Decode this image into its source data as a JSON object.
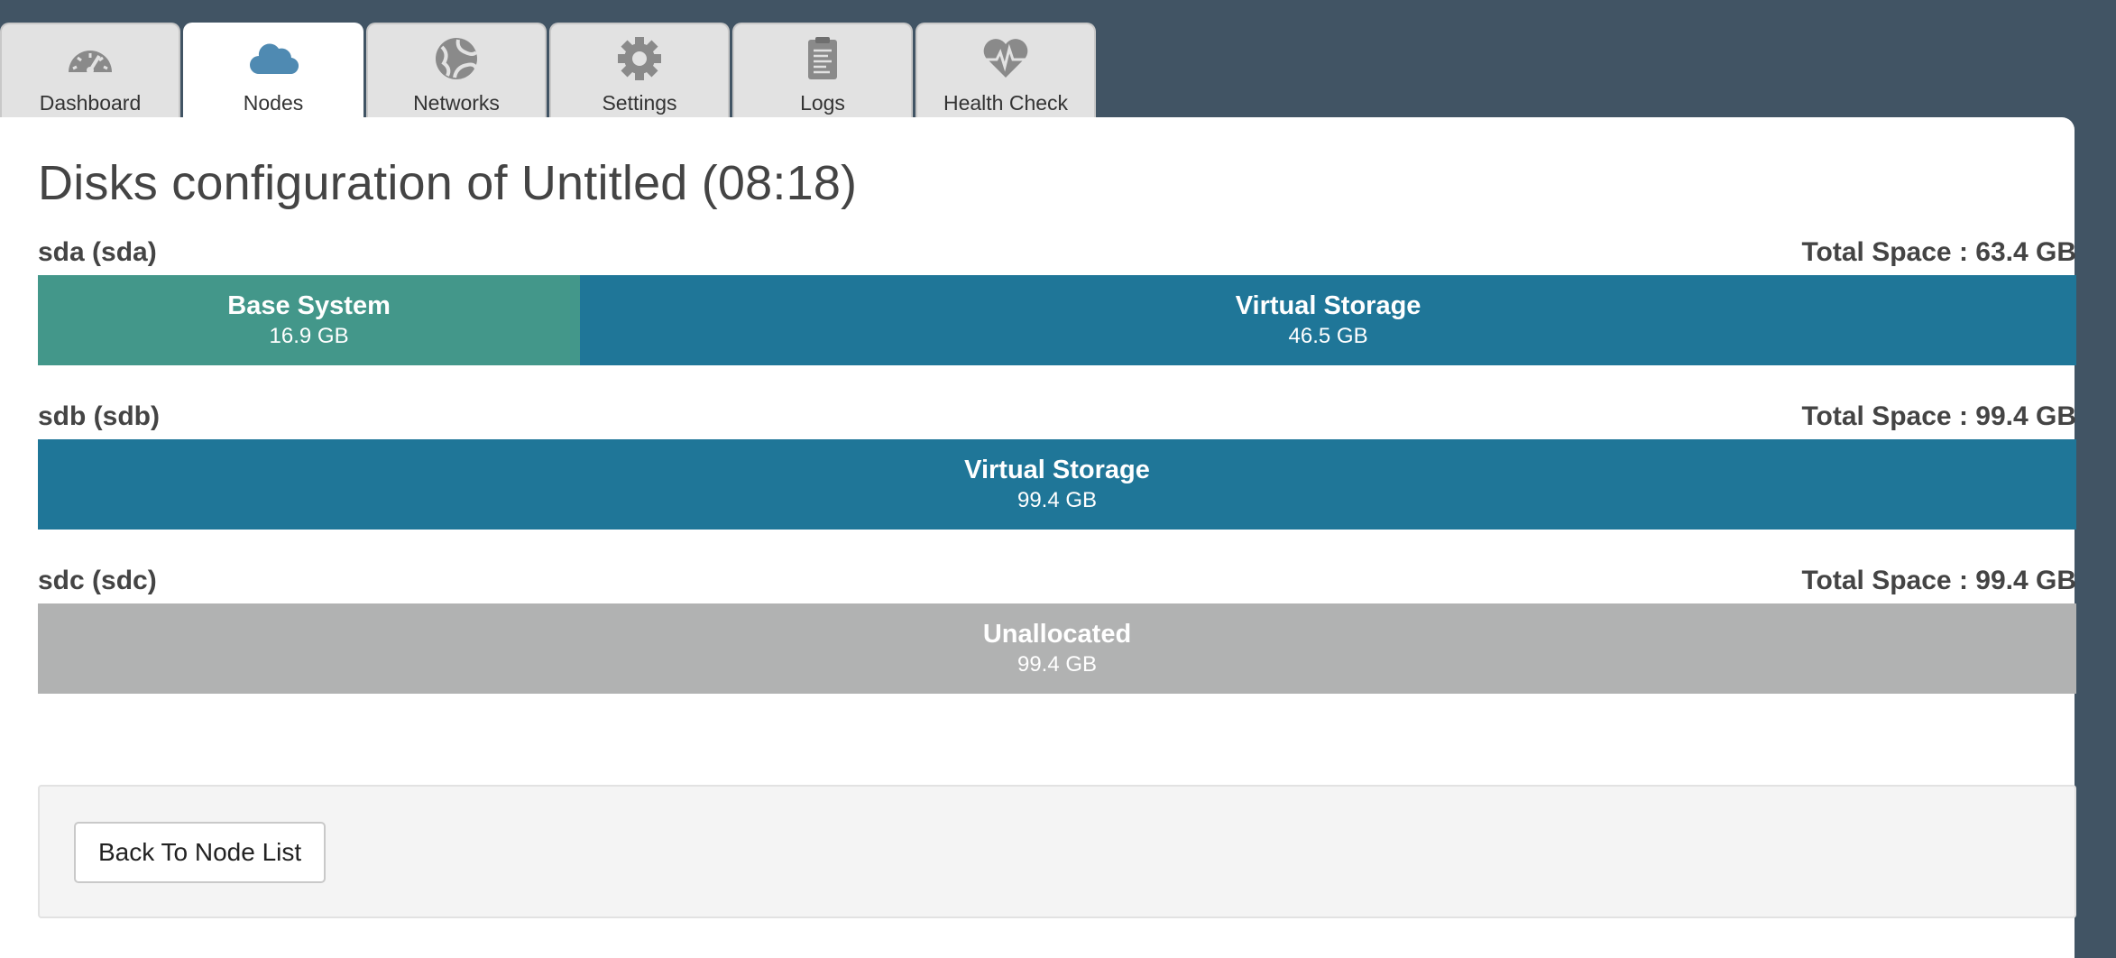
{
  "tabs": [
    {
      "label": "Dashboard",
      "icon": "speedometer-icon",
      "active": false
    },
    {
      "label": "Nodes",
      "icon": "cloud-icon",
      "active": true
    },
    {
      "label": "Networks",
      "icon": "globe-icon",
      "active": false
    },
    {
      "label": "Settings",
      "icon": "gear-icon",
      "active": false
    },
    {
      "label": "Logs",
      "icon": "clipboard-icon",
      "active": false
    },
    {
      "label": "Health Check",
      "icon": "heartbeat-icon",
      "active": false
    }
  ],
  "page": {
    "title": "Disks configuration of Untitled (08:18)"
  },
  "colors": {
    "background": "#415464",
    "base_system": "#43978a",
    "virtual_storage": "#1f7698",
    "unallocated": "#b1b2b2"
  },
  "disks": [
    {
      "name": "sda (sda)",
      "total": "Total Space : 63.4 GB",
      "segments": [
        {
          "name": "Base System",
          "size": "16.9 GB",
          "share": 0.266
        },
        {
          "name": "Virtual Storage",
          "size": "46.5 GB",
          "share": 0.734
        }
      ]
    },
    {
      "name": "sdb (sdb)",
      "total": "Total Space : 99.4 GB",
      "segments": [
        {
          "name": "Virtual Storage",
          "size": "99.4 GB",
          "share": 1.0
        }
      ]
    },
    {
      "name": "sdc (sdc)",
      "total": "Total Space : 99.4 GB",
      "segments": [
        {
          "name": "Unallocated",
          "size": "99.4 GB",
          "share": 1.0
        }
      ]
    }
  ],
  "footer": {
    "back_label": "Back To Node List"
  }
}
